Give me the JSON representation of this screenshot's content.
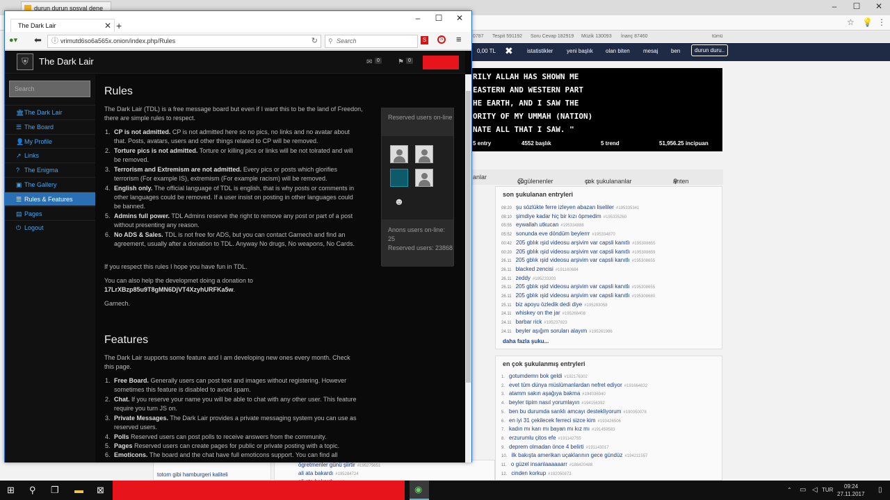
{
  "bg_browser": {
    "tab_title": "durun durun sosyal dene",
    "stats": [
      {
        "label": "0787"
      },
      {
        "label": "Tespit 591192"
      },
      {
        "label": "Soru Cevap 182919"
      },
      {
        "label": "Müzik 130093"
      },
      {
        "label": "İnanç 87460"
      },
      {
        "label": "tümü"
      }
    ],
    "menu": {
      "balance": "0,00 TL",
      "items": [
        "istatistikler",
        "yeni başlık",
        "olan biten",
        "mesaj",
        "ben",
        "durun duru.."
      ]
    },
    "banner": {
      "lines": [
        "RILY ALLAH HAS SHOWN ME",
        "EASTERN AND WESTERN PART",
        "HE EARTH, AND I SAW THE",
        "ORITY OF MY UMMAH (NATION)",
        "NATE ALL THAT I SAW. \""
      ],
      "stats": [
        "5 entry",
        "4552 başlık",
        "5 trend",
        "51,956.25 incipuan"
      ]
    },
    "subtabs": [
      "anlar",
      "çügülenenler",
      "çok şukulananlar",
      "anten"
    ],
    "recent_box": {
      "title": "son şukulanan entryleri",
      "rows": [
        {
          "t": "08:20",
          "text": "şu sözlükte ferre izleyen abazan liseliler",
          "n": "#195335341"
        },
        {
          "t": "08:10",
          "text": "şimdiye kadar hiç bir kızı öpmedim",
          "n": "#195335260"
        },
        {
          "t": "05:55",
          "text": "eywallah utkucan",
          "n": "#195334888"
        },
        {
          "t": "05:52",
          "text": "sonunda eve döndüm beylerrr",
          "n": "#195334870"
        },
        {
          "t": "00:42",
          "text": "205 gblık ışid videosu arşivim var capsli kanıtlı",
          "n": "#195308655"
        },
        {
          "t": "00:20",
          "text": "205 gblık ışid videosu arşivim var capsli kanıtlı",
          "n": "#195308659"
        },
        {
          "t": "26.11",
          "text": "205 gblık ışid videosu arşivim var capsli kanıtlı",
          "n": "#195308655"
        },
        {
          "t": "26.11",
          "text": "blacked zencisi",
          "n": "#191160684"
        },
        {
          "t": "26.11",
          "text": "zeddy",
          "n": "#195233303"
        },
        {
          "t": "26.11",
          "text": "205 gblık ışid videosu arşivim var capsli kanıtlı",
          "n": "#195308655"
        },
        {
          "t": "26.11",
          "text": "205 gblık ışid videosu arşivim var capsli kanıtlı",
          "n": "#195308680"
        },
        {
          "t": "25.11",
          "text": "biz apoyu özledik dedi diye",
          "n": "#195283058"
        },
        {
          "t": "24.11",
          "text": "whiskey on the jar",
          "n": "#195268408"
        },
        {
          "t": "24.11",
          "text": "barbar rick",
          "n": "#195237823"
        },
        {
          "t": "24.11",
          "text": "beyler aşığım soruları alayım",
          "n": "#195261986"
        }
      ],
      "more": "daha fazla şuku..."
    },
    "top_box": {
      "title": "en çok şukulanmış entryleri",
      "rows": [
        {
          "t": "1.",
          "text": "gotumdemn bok geldi",
          "n": "#192176302"
        },
        {
          "t": "2.",
          "text": "evet tüm dünya müslümanlardan nefret ediyor",
          "n": "#191664832"
        },
        {
          "t": "3.",
          "text": "atamm sakın aşağıya bakma",
          "n": "#194036940"
        },
        {
          "t": "4.",
          "text": "beyler tipim nasıl yorumlayın",
          "n": "#194156392"
        },
        {
          "t": "5.",
          "text": "ben bu durumda sarıklı amcayı destekliyorum",
          "n": "#190050078"
        },
        {
          "t": "6.",
          "text": "en iyi 31 çekilecek ferreci sizce kim",
          "n": "#193426506"
        },
        {
          "t": "7.",
          "text": "kadın mı karı mı bayan mı kız mı",
          "n": "#191459583"
        },
        {
          "t": "8.",
          "text": "erzurumlu çitos efe",
          "n": "#191142755"
        },
        {
          "t": "9.",
          "text": "deprem olmadan önce 4 belirti",
          "n": "#191143017"
        },
        {
          "t": "10.",
          "text": "ilk bakışta amerikan uçaklarının gece gündüz",
          "n": "#194211557"
        },
        {
          "t": "11.",
          "text": "o güzel insanlaaaaaarr",
          "n": "#188420488"
        },
        {
          "t": "12.",
          "text": "cinden korkup",
          "n": "#192050873"
        }
      ]
    },
    "left_bottom": [
      {
        "text": "totom gibi hamburgeri kaliteli",
        "n": ""
      },
      {
        "text": "ögretmenler günü şiirtir",
        "n": "#195275651"
      },
      {
        "text": "ali ata bakardı",
        "n": "#195284724"
      },
      {
        "text": "ali ata bakardı",
        "n": "#195"
      }
    ]
  },
  "fg_browser": {
    "tab_title": "The Dark Lair",
    "url": "vrimutd6so6a565x.onion/index.php/Rules",
    "search_placeholder": "Search"
  },
  "site": {
    "title": "The Dark Lair",
    "mail_count": "0",
    "flag_count": "0",
    "search_placeholder": "Search",
    "nav": [
      {
        "label": "The Dark Lair",
        "icon": "bank-icon",
        "glyph": "🏛"
      },
      {
        "label": "The Board",
        "icon": "list-icon",
        "glyph": "☰"
      },
      {
        "label": "My Profile",
        "icon": "user-icon",
        "glyph": "👤"
      },
      {
        "label": "Links",
        "icon": "external-link-icon",
        "glyph": "↗"
      },
      {
        "label": "The Enigma",
        "icon": "question-icon",
        "glyph": "?"
      },
      {
        "label": "The Gallery",
        "icon": "image-icon",
        "glyph": "▣"
      },
      {
        "label": "Rules & Features",
        "icon": "list-icon",
        "glyph": "☰"
      },
      {
        "label": "Pages",
        "icon": "file-icon",
        "glyph": "▤"
      },
      {
        "label": "Logout",
        "icon": "power-icon",
        "glyph": "⏻"
      }
    ],
    "rules": {
      "heading": "Rules",
      "intro": "The Dark Lair (TDL) is a free message board but even if I want this to be the land of Freedon, there are simple rules to respect.",
      "items": [
        {
          "title": "CP is not admitted.",
          "text": " CP is not admitted here so no pics, no links and no avatar about that. Posts, avatars, users and other things related to CP will be removed."
        },
        {
          "title": "Torture pics is not admitted.",
          "text": " Torture or killing pics or links will be not tolrated and will be removed."
        },
        {
          "title": "Terrorism and Extremism are not admitted.",
          "text": " Every pics or posts which glorifies terrorism (For example IS), extremism (For example racism) will be removed."
        },
        {
          "title": "English only.",
          "text": " The official language of TDL is english, that is why posts or comments in other languages could be removed. If a user insist on posting in other languages could be banned."
        },
        {
          "title": "Admins full power.",
          "text": " TDL Admins reserve the right to remove any post or part of a post without presenting any reason."
        },
        {
          "title": "No ADS & Sales.",
          "text": " TDL is not free for ADS, but you can contact Garnech and find an agreement, usually after a donation to TDL. Anyway No drugs, No weapons, No Cards."
        }
      ],
      "outro": "If you respect this rules I hope you have fun in TDL.",
      "donate_text": "You can also help the developmet doing a donation to",
      "donate_address": "17LrXBzp85u9T8gMN6DjVT4XzyhURFKa5w",
      "donate_suffix": ".",
      "signature": "Garnech."
    },
    "features": {
      "heading": "Features",
      "intro": "The Dark Lair supports some feature and I am developing new ones every month. Check this page.",
      "items": [
        {
          "title": "Free Board.",
          "text": " Generally users can post text and images without registering. However sometimes this feature is disabled to avoid spam."
        },
        {
          "title": "Chat.",
          "text": " If you reserve your name you will be able to chat with any other user. This feature require you turn JS on."
        },
        {
          "title": "Private Messages.",
          "text": " The Dark Lair provides a private messaging system you can use as reserved users."
        },
        {
          "title": "Polls",
          "text": " Reserved users can post polls to receive answers from the community."
        },
        {
          "title": "Pages",
          "text": " Reserved users can create pages for public or private posting with a topic."
        },
        {
          "title": "Emoticons.",
          "text": " The board and the chat have full emoticons support. You can find all"
        }
      ]
    },
    "panel": {
      "head": "Reserved users on-line",
      "anon": "Anons users on-line: 25",
      "reserved": "Reserved users: 23868"
    }
  },
  "taskbar": {
    "lang": "TUR",
    "time": "09:24",
    "date": "27.11.2017"
  }
}
